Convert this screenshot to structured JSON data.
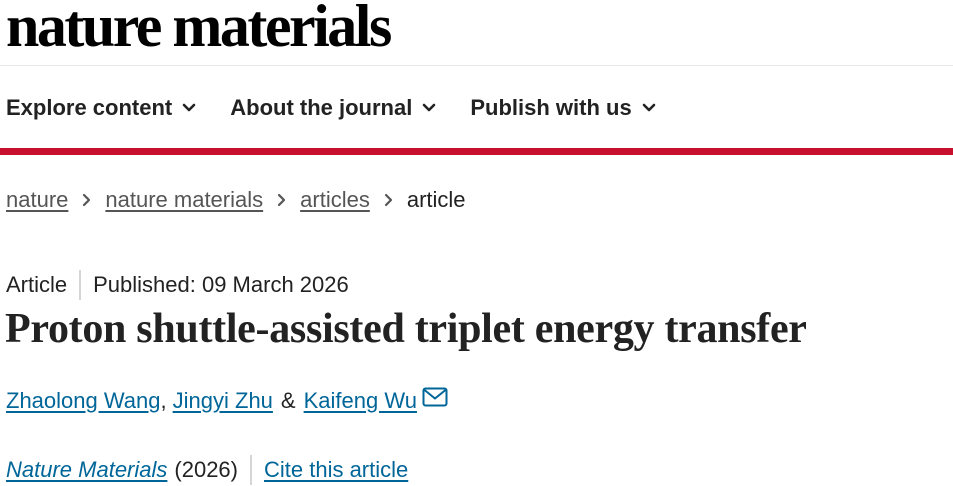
{
  "header": {
    "logo_text": "nature materials"
  },
  "nav": {
    "items": [
      {
        "label": "Explore content"
      },
      {
        "label": "About the journal"
      },
      {
        "label": "Publish with us"
      }
    ]
  },
  "breadcrumb": {
    "items": [
      {
        "label": "nature"
      },
      {
        "label": "nature materials"
      },
      {
        "label": "articles"
      }
    ],
    "current": "article"
  },
  "article": {
    "type": "Article",
    "published": "Published: 09 March 2026",
    "title": "Proton shuttle-assisted triplet energy transfer",
    "authors": [
      {
        "name": "Zhaolong Wang"
      },
      {
        "name": "Jingyi Zhu"
      },
      {
        "name": "Kaifeng Wu"
      }
    ],
    "author_separator_1": ",",
    "author_separator_2": "&",
    "journal": "Nature Materials",
    "year": "(2026)",
    "cite_label": "Cite this article"
  },
  "colors": {
    "accent_red": "#c8102e",
    "link_blue": "#006699",
    "text": "#222222"
  },
  "icons": [
    "chevron-down-icon",
    "chevron-right-icon",
    "mail-icon"
  ]
}
